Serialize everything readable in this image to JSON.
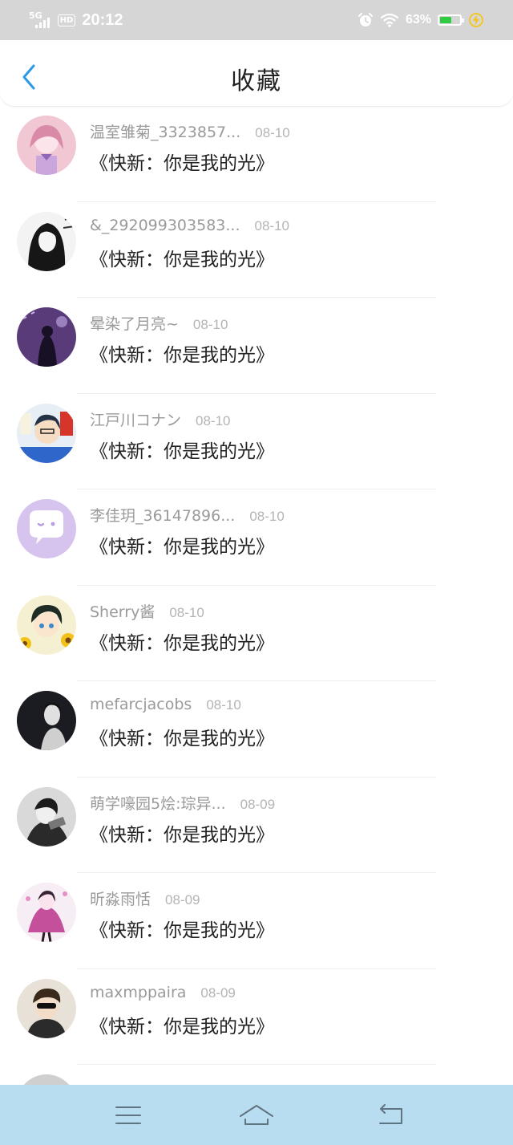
{
  "status_bar": {
    "network": "5G",
    "hd": "HD",
    "time": "20:12",
    "battery_percent_label": "63%",
    "battery_level": 0.63,
    "battery_color": "#2ecc40",
    "icons": [
      "signal-icon",
      "alarm-icon",
      "wifi-icon",
      "battery-icon",
      "charging-icon"
    ]
  },
  "header": {
    "title": "收藏",
    "back_icon": "chevron-left-icon",
    "accent_color": "#2a9be8"
  },
  "items": [
    {
      "user": "温室雏菊_3323857...",
      "date": "08-10",
      "title": "《快新：你是我的光》"
    },
    {
      "user": "&_292099303583...",
      "date": "08-10",
      "title": "《快新：你是我的光》"
    },
    {
      "user": "晕染了月亮~",
      "date": "08-10",
      "title": "《快新：你是我的光》"
    },
    {
      "user": "江戸川コナン",
      "date": "08-10",
      "title": "《快新：你是我的光》"
    },
    {
      "user": "李佳玥_36147896...",
      "date": "08-10",
      "title": "《快新：你是我的光》"
    },
    {
      "user": "Sherry酱",
      "date": "08-10",
      "title": "《快新：你是我的光》"
    },
    {
      "user": "mefarcjacobs",
      "date": "08-10",
      "title": "《快新：你是我的光》"
    },
    {
      "user": "萌学嚎园5烩:琮异...",
      "date": "08-09",
      "title": "《快新：你是我的光》"
    },
    {
      "user": "昕淼雨恬",
      "date": "08-09",
      "title": "《快新：你是我的光》"
    },
    {
      "user": "maxmppaira",
      "date": "08-09",
      "title": "《快新：你是我的光》"
    }
  ],
  "nav_bar": {
    "background": "#b8dcf0",
    "icons": [
      "menu-icon",
      "home-icon",
      "back-icon"
    ]
  }
}
